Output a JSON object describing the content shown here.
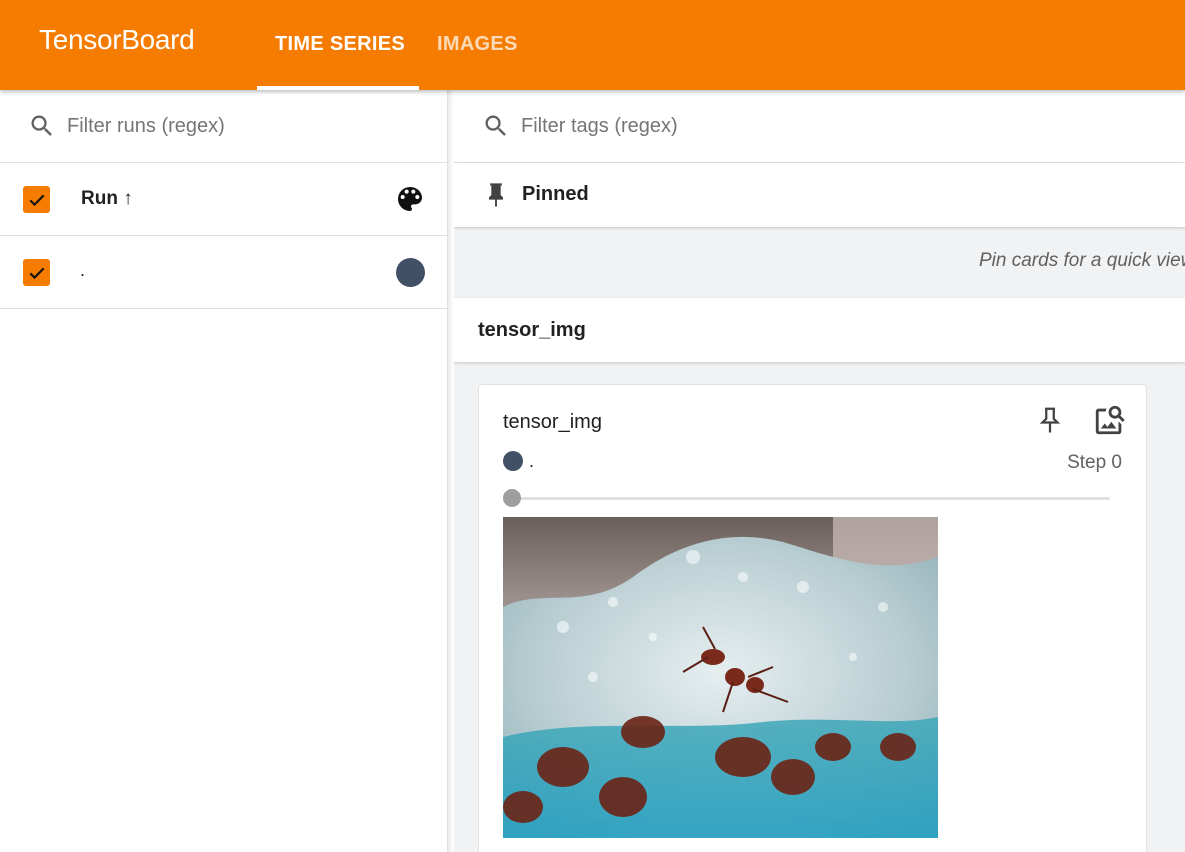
{
  "app": {
    "title": "TensorBoard"
  },
  "tabs": [
    {
      "label": "TIME SERIES",
      "active": true
    },
    {
      "label": "IMAGES",
      "active": false
    }
  ],
  "colors": {
    "brand": "#f57c00",
    "run_color": "#425066"
  },
  "sidebar": {
    "filter": {
      "placeholder": "Filter runs (regex)",
      "value": ""
    },
    "header": {
      "label": "Run ↑",
      "checked": true,
      "icon": "palette-icon"
    },
    "runs": [
      {
        "name": ".",
        "checked": true,
        "color": "#425066"
      }
    ]
  },
  "main": {
    "filter": {
      "placeholder": "Filter tags (regex)",
      "value": ""
    },
    "pinned": {
      "title": "Pinned",
      "icon": "pin-icon",
      "empty_message": "Pin cards for a quick view and comparison"
    },
    "group": {
      "title": "tensor_img"
    },
    "card": {
      "title": "tensor_img",
      "run": ".",
      "step_label": "Step 0",
      "slider_value": 0,
      "image_icon": "image-search-icon"
    }
  }
}
